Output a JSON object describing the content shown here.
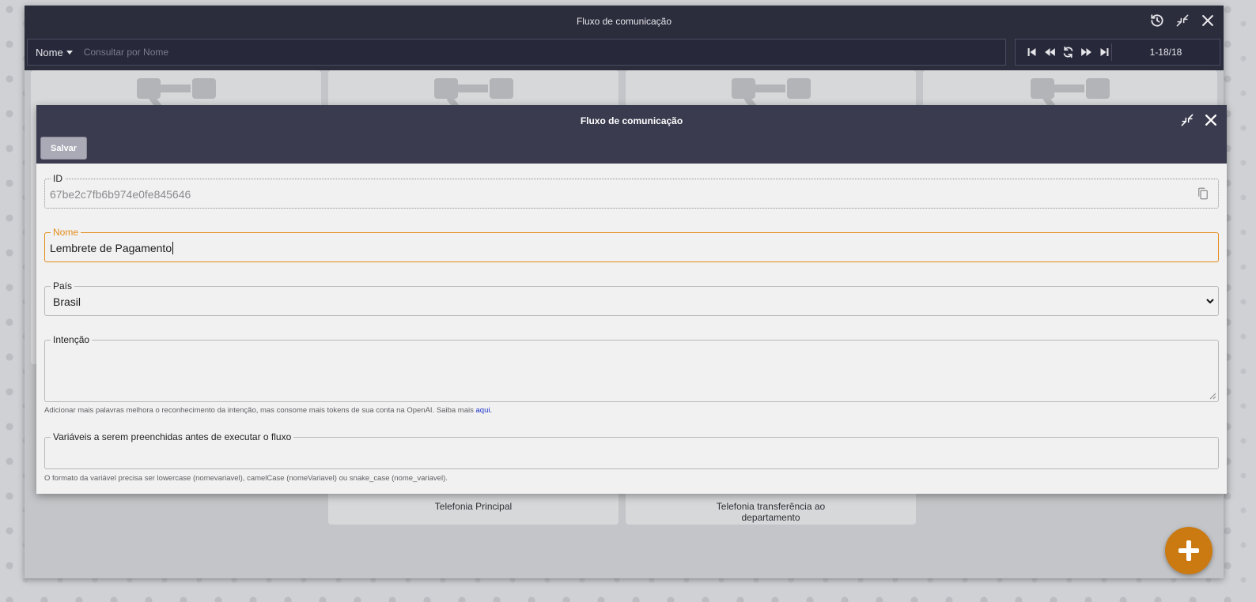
{
  "window": {
    "title": "Fluxo de comunicação"
  },
  "search": {
    "field_label": "Nome",
    "placeholder": "Consultar por Nome"
  },
  "pager": {
    "count": "1-18/18"
  },
  "cards": [
    {
      "label": ""
    },
    {
      "label": "Telefonia Principal"
    },
    {
      "label": "Telefonia transferência ao departamento"
    },
    {
      "label": ""
    }
  ],
  "modal": {
    "title": "Fluxo de comunicação",
    "save_label": "Salvar",
    "fields": {
      "id": {
        "label": "ID",
        "value": "67be2c7fb6b974e0fe845646"
      },
      "nome": {
        "label": "Nome",
        "value": "Lembrete de Pagamento"
      },
      "pais": {
        "label": "País",
        "value": "Brasil"
      },
      "intencao": {
        "label": "Intenção",
        "value": "",
        "hint": "Adicionar mais palavras melhora o reconhecimento da intenção, mas consome mais tokens de sua conta na OpenAI. Saiba mais",
        "hint_link": "aqui."
      },
      "variaveis": {
        "label": "Variáveis a serem preenchidas antes de executar o fluxo",
        "value": "",
        "hint": "O formato da variável precisa ser lowercase (nomevariavel), camelCase (nomeVariavel) ou snake_case (nome_variavel)."
      }
    }
  },
  "colors": {
    "header_dark": "#2b2c3c",
    "modal_header": "#3a3b4f",
    "accent": "#e38c1a",
    "fab": "#cb7a12"
  },
  "icons": [
    "history-icon",
    "collapse-icon",
    "close-icon",
    "first-page-icon",
    "previous-page-icon",
    "refresh-icon",
    "next-page-icon",
    "last-page-icon",
    "copy-icon",
    "chevron-down-icon",
    "plus-icon"
  ]
}
